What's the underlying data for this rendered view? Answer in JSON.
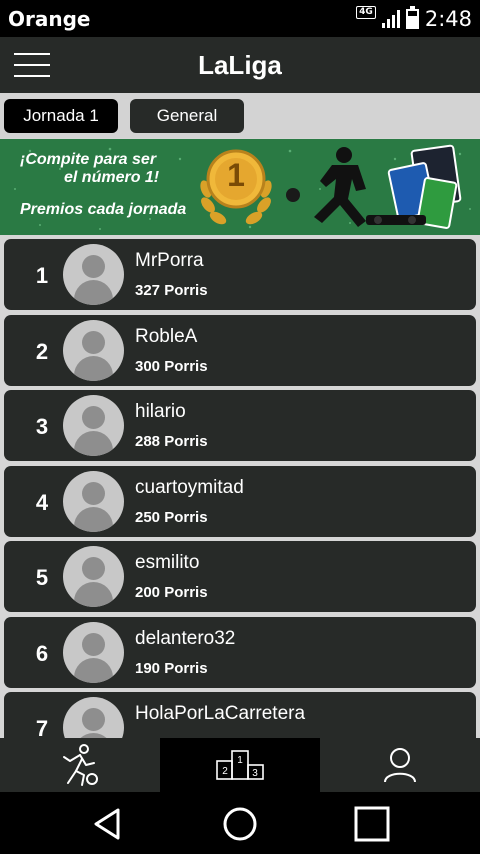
{
  "status_bar": {
    "carrier": "Orange",
    "network": "4G",
    "time": "2:48"
  },
  "app_bar": {
    "title": "LaLiga"
  },
  "tabs": [
    {
      "label": "Jornada 1",
      "active": true
    },
    {
      "label": "General",
      "active": false
    }
  ],
  "banner": {
    "line1": "¡Compite para ser",
    "line2": "el número 1!",
    "line3": "Premios cada jornada",
    "medal_number": "1"
  },
  "ranking": [
    {
      "rank": "1",
      "username": "MrPorra",
      "points": "327 Porris"
    },
    {
      "rank": "2",
      "username": "RobleA",
      "points": "300 Porris"
    },
    {
      "rank": "3",
      "username": "hilario",
      "points": "288 Porris"
    },
    {
      "rank": "4",
      "username": "cuartoymitad",
      "points": "250 Porris"
    },
    {
      "rank": "5",
      "username": "esmilito",
      "points": "200 Porris"
    },
    {
      "rank": "6",
      "username": "delantero32",
      "points": "190 Porris"
    },
    {
      "rank": "7",
      "username": "HolaPorLaCarretera",
      "points": ""
    }
  ],
  "bottom_nav": {
    "items": [
      {
        "icon": "player-kick-icon",
        "active": false
      },
      {
        "icon": "podium-icon",
        "active": true,
        "podium_labels": [
          "1",
          "2",
          "3"
        ]
      },
      {
        "icon": "user-icon",
        "active": false
      }
    ]
  },
  "colors": {
    "bar_dark": "#272a28",
    "background_gray": "#d6d6d6",
    "banner_green": "#2a7a44",
    "medal_gold": "#e0a429"
  }
}
